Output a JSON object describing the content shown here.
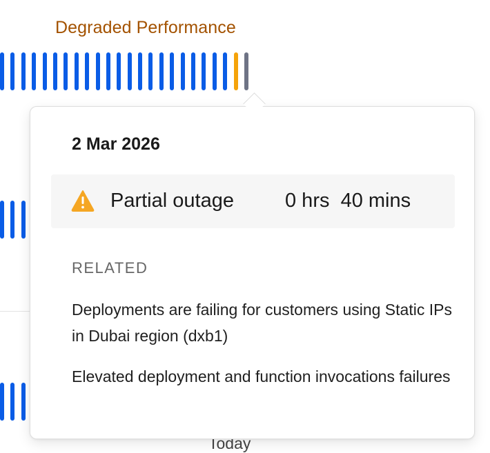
{
  "status_label": "Degraded Performance",
  "today_label": "Today",
  "bars": {
    "row1": [
      "operational",
      "operational",
      "operational",
      "operational",
      "operational",
      "operational",
      "operational",
      "operational",
      "operational",
      "operational",
      "operational",
      "operational",
      "operational",
      "operational",
      "operational",
      "operational",
      "operational",
      "operational",
      "operational",
      "operational",
      "operational",
      "operational",
      "degraded",
      "nodata"
    ],
    "row2": [
      "operational",
      "operational",
      "operational"
    ],
    "row3": [
      "operational",
      "operational",
      "operational"
    ]
  },
  "colors": {
    "operational": "#0a5ce6",
    "degraded": "#f5a30a",
    "nodata": "#6e7385",
    "status_label": "#a35200",
    "warning_icon": "#f5a623"
  },
  "tooltip": {
    "date": "2 Mar 2026",
    "incident": {
      "icon": "warning-icon",
      "type": "Partial outage",
      "duration": "0 hrs  40 mins"
    },
    "related_heading": "RELATED",
    "related": [
      "Deployments are failing for customers using Static IPs in Dubai region (dxb1)",
      "Elevated deployment and function invocations failures"
    ]
  }
}
